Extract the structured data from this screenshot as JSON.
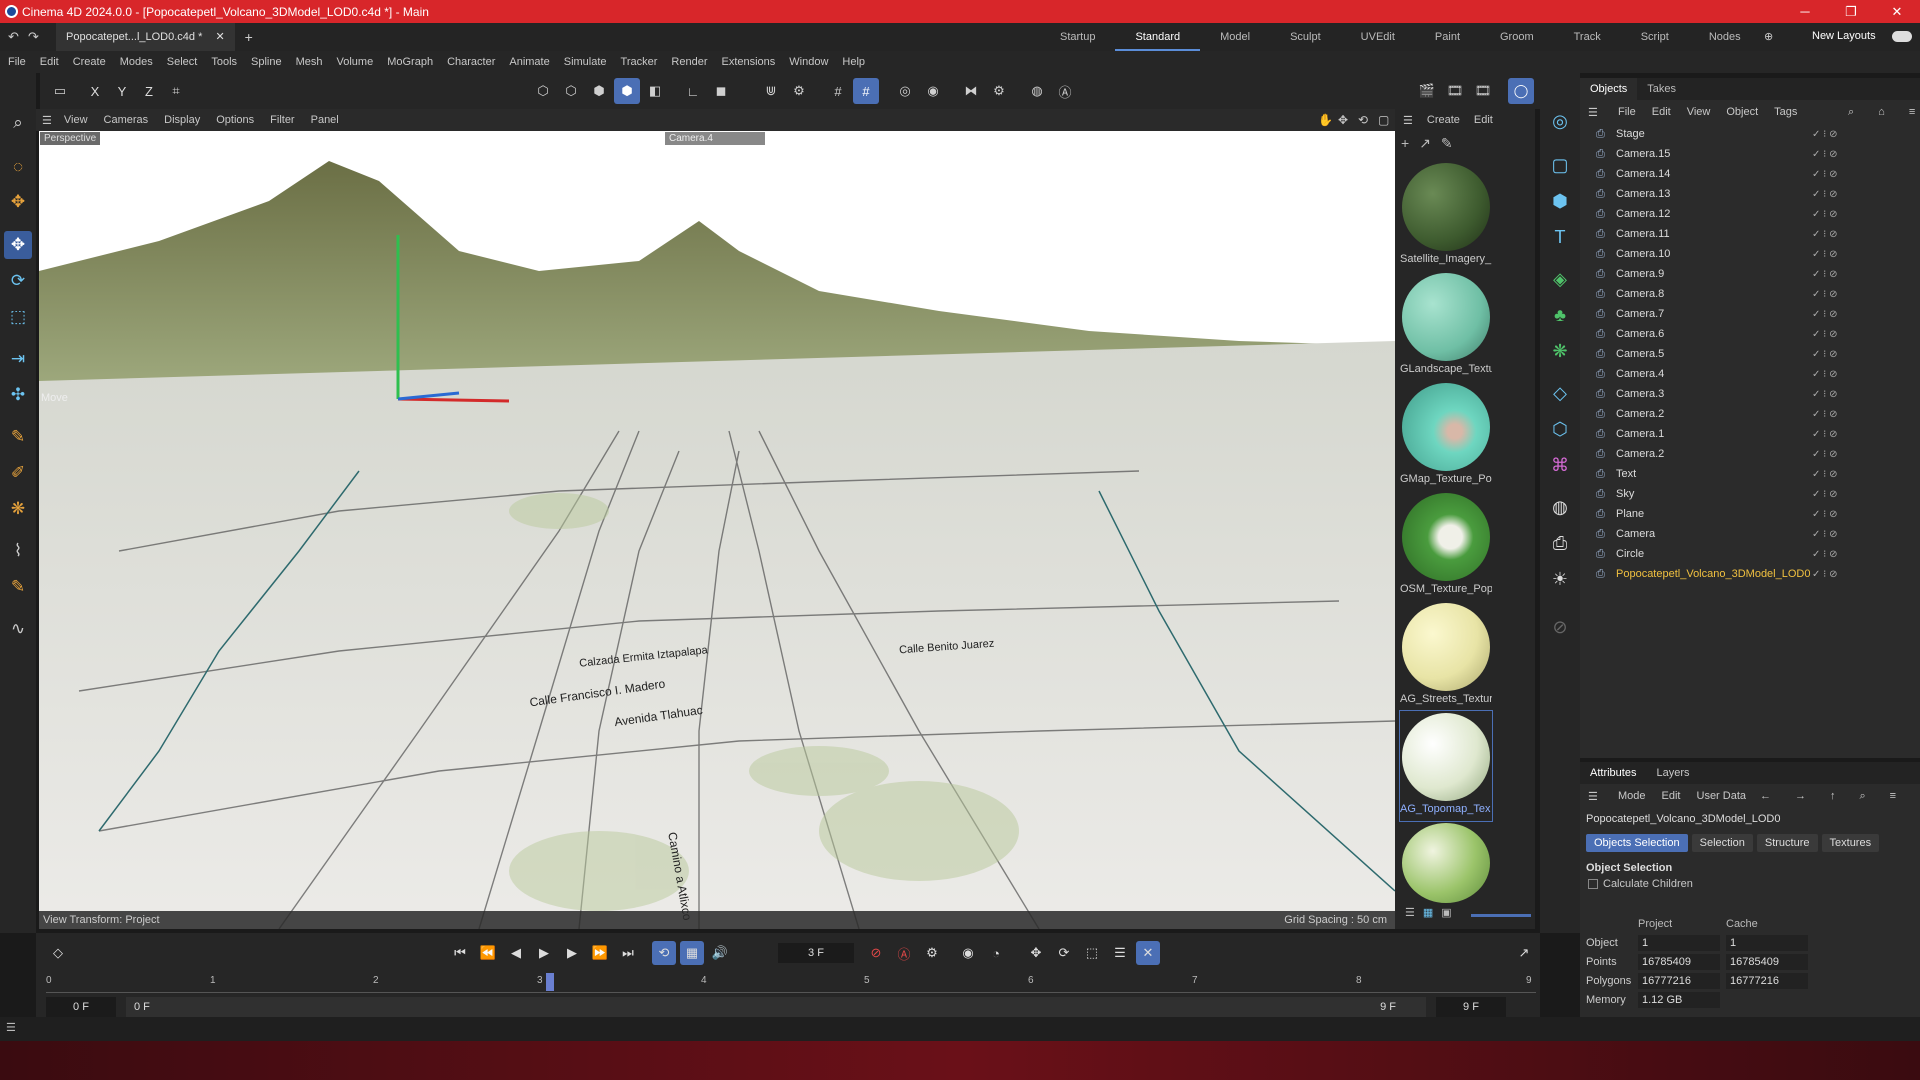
{
  "titlebar": {
    "title": "Cinema 4D 2024.0.0 - [Popocatepetl_Volcano_3DModel_LOD0.c4d *] - Main"
  },
  "doc_tab": "Popocatepet...l_LOD0.c4d *",
  "layouts": [
    "Startup",
    "Standard",
    "Model",
    "Sculpt",
    "UVEdit",
    "Paint",
    "Groom",
    "Track",
    "Script",
    "Nodes"
  ],
  "new_layouts": "New Layouts",
  "menu": [
    "File",
    "Edit",
    "Create",
    "Modes",
    "Select",
    "Tools",
    "Spline",
    "Mesh",
    "Volume",
    "MoGraph",
    "Character",
    "Animate",
    "Simulate",
    "Tracker",
    "Render",
    "Extensions",
    "Window",
    "Help"
  ],
  "axes": {
    "x": "X",
    "y": "Y",
    "z": "Z"
  },
  "viewport": {
    "menu": [
      "View",
      "Cameras",
      "Display",
      "Options",
      "Filter",
      "Panel"
    ],
    "projection": "Perspective",
    "camera": "Camera.4",
    "status": "View Transform: Project",
    "grid": "Grid Spacing : 50 cm",
    "move_label": "Move",
    "street_labels": [
      "Calle Francisco I. Madero",
      "Avenida Tlahuac",
      "Calzada Ermita Iztapalapa",
      "Calle Benito Juarez",
      "Camino a Atlixco"
    ]
  },
  "materials": {
    "menu": [
      "Create",
      "Edit"
    ],
    "items": [
      {
        "name": "Satellite_Imagery_",
        "color": "#3d5a2e"
      },
      {
        "name": "GLandscape_Textu",
        "color": "#6fbfa5"
      },
      {
        "name": "GMap_Texture_Po",
        "color": "#6ed6c0"
      },
      {
        "name": "OSM_Texture_Pop",
        "color": "#4a9c3e"
      },
      {
        "name": "AG_Streets_Textur",
        "color": "#e8e4a6"
      },
      {
        "name": "AG_Topomap_Tex",
        "color": "#dfe8cf"
      },
      {
        "name": "",
        "color": "#9bc46a"
      }
    ]
  },
  "objects": {
    "tabs": [
      "Objects",
      "Takes"
    ],
    "menu": [
      "File",
      "Edit",
      "View",
      "Object",
      "Tags"
    ],
    "items": [
      "Stage",
      "Camera.15",
      "Camera.14",
      "Camera.13",
      "Camera.12",
      "Camera.11",
      "Camera.10",
      "Camera.9",
      "Camera.8",
      "Camera.7",
      "Camera.6",
      "Camera.5",
      "Camera.4",
      "Camera.3",
      "Camera.2",
      "Camera.1",
      "Camera.2",
      "Text",
      "Sky",
      "Plane",
      "Camera",
      "Circle",
      "Popocatepetl_Volcano_3DModel_LOD0"
    ]
  },
  "attributes": {
    "tabs": [
      "Attributes",
      "Layers"
    ],
    "menu": [
      "Mode",
      "Edit",
      "User Data"
    ],
    "object_name": "Popocatepetl_Volcano_3DModel_LOD0",
    "buttons": [
      "Objects Selection",
      "Selection",
      "Structure",
      "Textures"
    ],
    "section": "Object Selection",
    "checkbox": "Calculate Children",
    "col_project": "Project",
    "col_cache": "Cache",
    "rows": [
      {
        "k": "Object",
        "p": "1",
        "c": "1"
      },
      {
        "k": "Points",
        "p": "16785409",
        "c": "16785409"
      },
      {
        "k": "Polygons",
        "p": "16777216",
        "c": "16777216"
      },
      {
        "k": "Memory",
        "p": "1.12 GB",
        "c": ""
      }
    ]
  },
  "timeline": {
    "current_frame": "3 F",
    "ticks": [
      "0",
      "1",
      "2",
      "3",
      "4",
      "5",
      "6",
      "7",
      "8",
      "9"
    ],
    "start": "0 F",
    "start2": "0 F",
    "end": "9 F",
    "end2": "9 F"
  },
  "colors": {
    "accent": "#4b6fb5",
    "title": "#d8262a"
  }
}
